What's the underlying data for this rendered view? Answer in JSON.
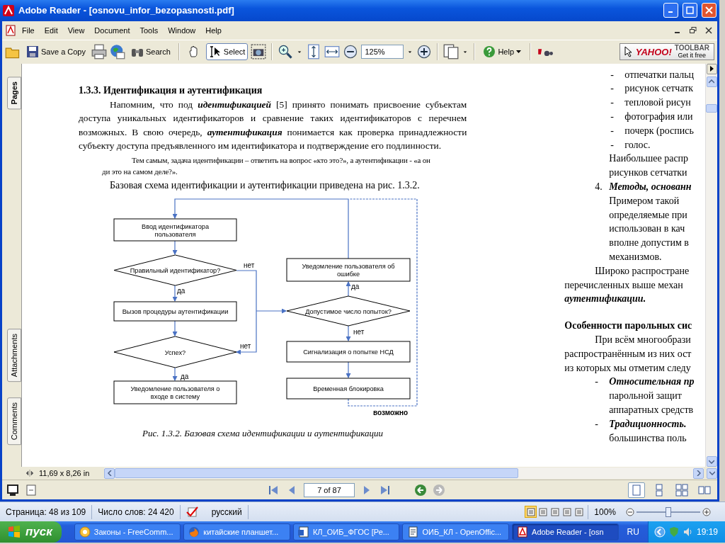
{
  "window": {
    "title": "Adobe Reader - [osnovu_infor_bezopasnosti.pdf]"
  },
  "menu": [
    "File",
    "Edit",
    "View",
    "Document",
    "Tools",
    "Window",
    "Help"
  ],
  "toolbar": {
    "save_label": "Save a Copy",
    "search_label": "Search",
    "hand_tool": {
      "selected": false
    },
    "select_tool": {
      "label": "Select",
      "selected": true
    },
    "zoom_value": "125%",
    "help_label": "Help",
    "yahoo": {
      "logo": "YAHOO!",
      "title": "TOOLBAR",
      "tagline": "Get it free"
    }
  },
  "side_tabs": [
    {
      "label": "Pages"
    },
    {
      "label": "Attachments"
    },
    {
      "label": "Comments"
    }
  ],
  "document": {
    "left_column": {
      "heading": "1.3.3. Идентификация и аутентификация",
      "paragraph": "Напомним, что под **идентификацией** [5] принято понимать присвоение субъектам доступа уникальных идентификаторов и сравнение таких идентификаторов с перечнем возможных. В свою очередь, **аутентификация** понимается как проверка принадлежности субъекту доступа предъявленного им идентификатора и подтверждение его подлинности.",
      "note_lines": [
        "Тем самым, задача идентификации – ответить на вопрос «кто это?», а аутентификации -  «а он",
        "ди это на самом деле?»."
      ],
      "intro": "Базовая схема идентификации и аутентификации приведена на рис. 1.3.2.",
      "figure": {
        "nodes": [
          {
            "kind": "box",
            "lines": [
              "Ввод идентификатора",
              "пользователя"
            ]
          },
          {
            "kind": "decision",
            "lines": [
              "Правильный идентификатор?"
            ]
          },
          {
            "kind": "box",
            "lines": [
              "Вызов процедуры аутентификации"
            ]
          },
          {
            "kind": "decision",
            "lines": [
              "Успех?"
            ]
          },
          {
            "kind": "box",
            "lines": [
              "Уведомление пользователя о",
              "входе в систему"
            ]
          },
          {
            "kind": "box",
            "lines": [
              "Уведомление пользователя об",
              "ошибке"
            ]
          },
          {
            "kind": "decision",
            "lines": [
              "Допустимое число попыток?"
            ]
          },
          {
            "kind": "box",
            "lines": [
              "Сигнализация о попытке НСД"
            ]
          },
          {
            "kind": "box",
            "lines": [
              "Временная блокировка"
            ]
          }
        ],
        "edge_labels": [
          "нет",
          "да",
          "нет",
          "да",
          "да",
          "нет",
          "возможно"
        ],
        "caption": "Рис. 1.3.2. Базовая схема идентификации и аутентификации"
      }
    },
    "right_column": [
      {
        "kind": "bullet",
        "marker": "-",
        "text": "отпечатки пальц"
      },
      {
        "kind": "bullet",
        "marker": "-",
        "text": "рисунок сетчатк"
      },
      {
        "kind": "bullet",
        "marker": "-",
        "text": "тепловой рисун"
      },
      {
        "kind": "bullet",
        "marker": "-",
        "text": "фотография или"
      },
      {
        "kind": "bullet",
        "marker": "-",
        "text": "почерк (роспись"
      },
      {
        "kind": "bullet",
        "marker": "-",
        "text": "голос."
      },
      {
        "kind": "indent",
        "text": "Наибольшее распр"
      },
      {
        "kind": "indent",
        "text": "рисунков сетчатки"
      },
      {
        "kind": "number-emph",
        "marker": "4.",
        "text": "Методы, основанн"
      },
      {
        "kind": "indent",
        "text": "Примером такой"
      },
      {
        "kind": "indent",
        "text": "определяемые при"
      },
      {
        "kind": "indent",
        "text": "использован в кач"
      },
      {
        "kind": "indent",
        "text": "вполне допустим в"
      },
      {
        "kind": "indent",
        "text": "механизмов."
      },
      {
        "kind": "para",
        "text": "Широко распростране"
      },
      {
        "kind": "plain",
        "text": "перечисленных выше механ"
      },
      {
        "kind": "plain-emph",
        "text": "аутентификации."
      },
      {
        "kind": "heading",
        "text": "Особенности парольных сис"
      },
      {
        "kind": "para",
        "text": "При всём многообрази"
      },
      {
        "kind": "plain",
        "text": "распространённым из них ост"
      },
      {
        "kind": "plain",
        "text": "из которых мы отметим следу"
      },
      {
        "kind": "bullet-emph",
        "marker": "-",
        "text": "Относительная пр"
      },
      {
        "kind": "indent",
        "text": "парольной защит"
      },
      {
        "kind": "indent",
        "text": "аппаратных средств"
      },
      {
        "kind": "bullet-emph",
        "marker": "-",
        "text": "Традиционность."
      },
      {
        "kind": "indent",
        "text": "большинства поль"
      }
    ]
  },
  "page_size": "11,69 x 8,26 in",
  "navigation": {
    "page_field": "7 of 87",
    "view_modes": [
      {
        "kind": "single",
        "selected": true
      },
      {
        "kind": "continuous",
        "selected": false
      },
      {
        "kind": "facing-continuous",
        "selected": false
      },
      {
        "kind": "facing",
        "selected": false
      }
    ]
  },
  "status_bar": {
    "page": "Страница: 48 из 109",
    "words": "Число слов: 24 420",
    "language": "русский",
    "views": [
      {
        "selected": true
      },
      {
        "selected": false
      },
      {
        "selected": false
      },
      {
        "selected": false
      },
      {
        "selected": false
      }
    ],
    "zoom": "100%",
    "zoom_slider": {
      "level": 0.5
    }
  },
  "taskbar": {
    "start": "пуск",
    "tasks": [
      {
        "kind": "globe",
        "label": "Законы - FreeComm...",
        "selected": false
      },
      {
        "kind": "firefox",
        "label": "китайские планшет...",
        "selected": false
      },
      {
        "kind": "word",
        "label": "КЛ_ОИБ_ФГОС [Ре...",
        "selected": false
      },
      {
        "kind": "writer",
        "label": "ОИБ_КЛ - OpenOffic...",
        "selected": false
      },
      {
        "kind": "pdf",
        "label": "Adobe Reader - [osn",
        "selected": true
      }
    ],
    "language": "RU",
    "clock": "19:19"
  }
}
